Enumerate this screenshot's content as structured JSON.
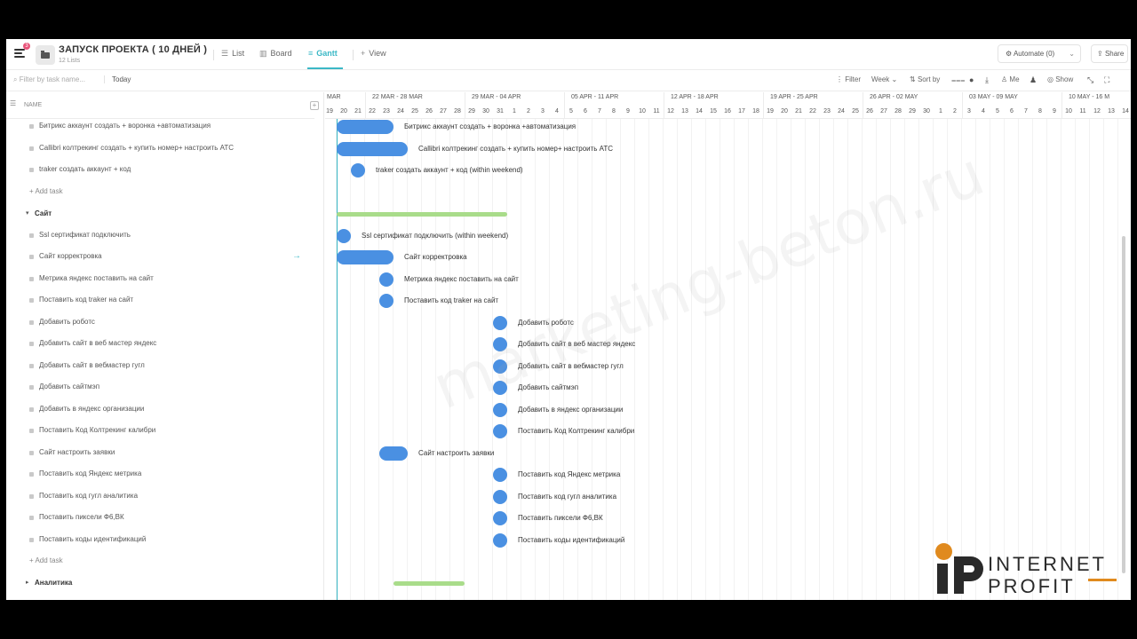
{
  "header": {
    "notification_count": "3",
    "project_title": "ЗАПУСК ПРОЕКТА ( 10 ДНЕЙ )",
    "project_sub": "12 Lists",
    "tabs": [
      {
        "label": "List",
        "icon": "list-icon"
      },
      {
        "label": "Board",
        "icon": "board-icon"
      },
      {
        "label": "Gantt",
        "icon": "gantt-icon"
      },
      {
        "label": "View",
        "icon": "plus-icon"
      }
    ],
    "automate": "Automate (0)",
    "share": "Share"
  },
  "toolbar": {
    "search_placeholder": "Filter by task name...",
    "today": "Today",
    "filter": "Filter",
    "week": "Week",
    "sort": "Sort by",
    "me": "Me",
    "show": "Show"
  },
  "left": {
    "column_name": "NAME",
    "rows": [
      {
        "type": "task",
        "label": "Битрикс аккаунт создать + воронка +автоматизация"
      },
      {
        "type": "task",
        "label": "Callibri колтрекинг создать + купить номер+ настроить АТС"
      },
      {
        "type": "task",
        "label": "traker создать аккаунт + код"
      },
      {
        "type": "add",
        "label": "+ Add task"
      },
      {
        "type": "group",
        "label": "Сайт"
      },
      {
        "type": "task",
        "label": "Ssl сертификат подключить"
      },
      {
        "type": "task",
        "label": "Сайт корректровка"
      },
      {
        "type": "task",
        "label": "Метрика яндекс поставить на сайт"
      },
      {
        "type": "task",
        "label": "Поставить код traker на сайт"
      },
      {
        "type": "task",
        "label": "Добавить роботс"
      },
      {
        "type": "task",
        "label": "Добавить сайт в веб мастер яндекс"
      },
      {
        "type": "task",
        "label": "Добавить сайт в вебмастер гугл"
      },
      {
        "type": "task",
        "label": "Добавить сайтмэп"
      },
      {
        "type": "task",
        "label": "Добавить в яндекс организации"
      },
      {
        "type": "task",
        "label": "Поставить Код Колтрекинг калибри"
      },
      {
        "type": "task",
        "label": "Сайт настроить заявки"
      },
      {
        "type": "task",
        "label": "Поставить код Яндекс метрика"
      },
      {
        "type": "task",
        "label": "Поставить код гугл аналитика"
      },
      {
        "type": "task",
        "label": "Поставить пиксели Ф6,ВК"
      },
      {
        "type": "task",
        "label": "Поставить коды идентификаций"
      },
      {
        "type": "add",
        "label": "+ Add task"
      },
      {
        "type": "group-collapsed",
        "label": "Аналитика"
      }
    ]
  },
  "gantt": {
    "weeks": [
      "MAR",
      "22 MAR - 28 MAR",
      "29 MAR - 04 APR",
      "05 APR - 11 APR",
      "12 APR - 18 APR",
      "19 APR - 25 APR",
      "26 APR - 02 MAY",
      "03 MAY - 09 MAY",
      "10 MAY - 16 M"
    ],
    "days": [
      "19",
      "20",
      "21",
      "22",
      "23",
      "24",
      "25",
      "26",
      "27",
      "28",
      "29",
      "30",
      "31",
      "1",
      "2",
      "3",
      "4",
      "5",
      "6",
      "7",
      "8",
      "9",
      "10",
      "11",
      "12",
      "13",
      "14",
      "15",
      "16",
      "17",
      "18",
      "19",
      "20",
      "21",
      "22",
      "23",
      "24",
      "25",
      "26",
      "27",
      "28",
      "29",
      "30",
      "1",
      "2",
      "3",
      "4",
      "5",
      "6",
      "7",
      "8",
      "9",
      "10",
      "11",
      "12",
      "13",
      "14"
    ],
    "labels": [
      "Битрикс аккаунт создать + воронка +автоматизация",
      "Callibri колтрекинг создать + купить номер+ настроить АТС",
      "traker создать аккаунт + код (within weekend)",
      "Ssl сертификат подключить (within weekend)",
      "Сайт корректровка",
      "Метрика яндекс поставить на сайт",
      "Поставить код traker на сайт",
      "Добавить роботс",
      "Добавить сайт в веб мастер яндекс",
      "Добавить сайт в вебмастер гугл",
      "Добавить сайтмэп",
      "Добавить в яндекс организации",
      "Поставить Код Колтрекинг калибри",
      "Сайт настроить заявки",
      "Поставить код Яндекс метрика",
      "Поставить код гугл аналитика",
      "Поставить пиксели Ф6,ВК",
      "Поставить коды идентификаций"
    ]
  },
  "watermark": "marketing-beton.ru",
  "logo": {
    "line1": "INTERNET",
    "line2": "PROFIT"
  },
  "colors": {
    "accent": "#3bb8c6",
    "bar": "#4a90e2",
    "group_bar": "#a9dc8a",
    "logo_orange": "#e08a1e"
  }
}
